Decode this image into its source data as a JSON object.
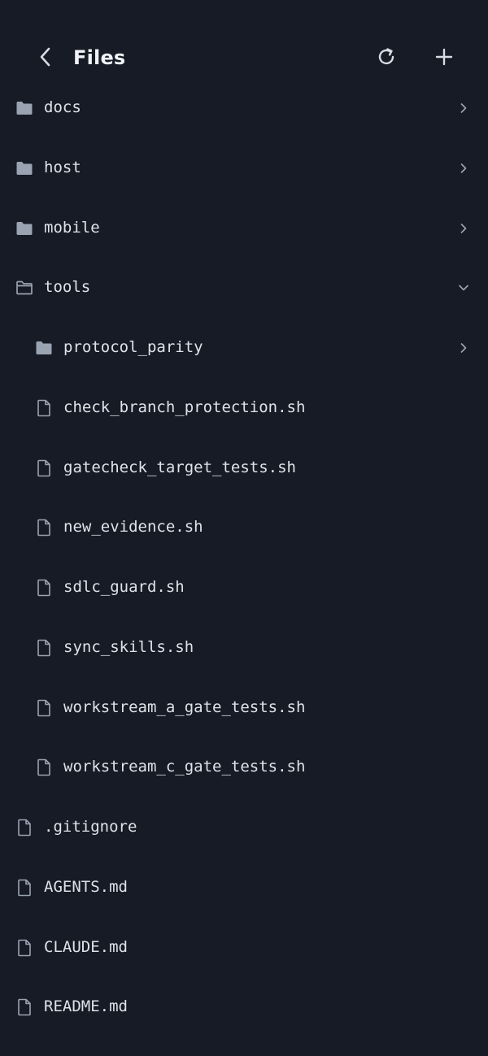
{
  "header": {
    "title": "Files",
    "back_icon": "chevron-left-icon",
    "refresh_icon": "refresh-icon",
    "add_icon": "plus-icon"
  },
  "colors": {
    "background": "#161b25",
    "text": "#dfe3e9",
    "icon": "#9aa3b2",
    "folder_fill": "#9aa3b2"
  },
  "tree": [
    {
      "name": "docs",
      "type": "folder",
      "level": 0,
      "expanded": false
    },
    {
      "name": "host",
      "type": "folder",
      "level": 0,
      "expanded": false
    },
    {
      "name": "mobile",
      "type": "folder",
      "level": 0,
      "expanded": false
    },
    {
      "name": "tools",
      "type": "folder",
      "level": 0,
      "expanded": true
    },
    {
      "name": "protocol_parity",
      "type": "folder",
      "level": 1,
      "expanded": false
    },
    {
      "name": "check_branch_protection.sh",
      "type": "file",
      "level": 1
    },
    {
      "name": "gatecheck_target_tests.sh",
      "type": "file",
      "level": 1
    },
    {
      "name": "new_evidence.sh",
      "type": "file",
      "level": 1
    },
    {
      "name": "sdlc_guard.sh",
      "type": "file",
      "level": 1
    },
    {
      "name": "sync_skills.sh",
      "type": "file",
      "level": 1
    },
    {
      "name": "workstream_a_gate_tests.sh",
      "type": "file",
      "level": 1
    },
    {
      "name": "workstream_c_gate_tests.sh",
      "type": "file",
      "level": 1
    },
    {
      "name": ".gitignore",
      "type": "file",
      "level": 0
    },
    {
      "name": "AGENTS.md",
      "type": "file",
      "level": 0
    },
    {
      "name": "CLAUDE.md",
      "type": "file",
      "level": 0
    },
    {
      "name": "README.md",
      "type": "file",
      "level": 0
    }
  ]
}
